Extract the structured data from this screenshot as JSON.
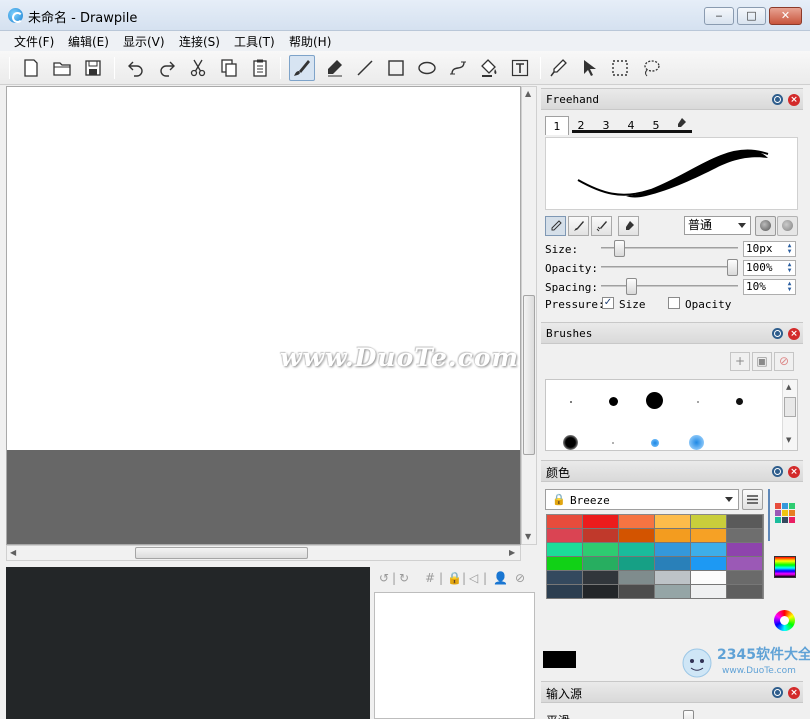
{
  "window": {
    "title": "未命名 - Drawpile",
    "min": "‒",
    "max": "□",
    "close": "✕"
  },
  "menu": [
    "文件(F)",
    "编辑(E)",
    "显示(V)",
    "连接(S)",
    "工具(T)",
    "帮助(H)"
  ],
  "toolbar_icons": [
    "new-file-icon",
    "open-folder-icon",
    "save-icon",
    "undo-icon",
    "redo-icon",
    "cut-icon",
    "copy-icon",
    "paste-icon",
    "freehand-brush-icon",
    "eraser-marker-icon",
    "line-icon",
    "rectangle-icon",
    "ellipse-icon",
    "bezier-icon",
    "fill-bucket-icon",
    "text-tool-icon",
    "color-picker-icon",
    "laser-pointer-icon",
    "rectangle-select-icon",
    "lasso-select-icon"
  ],
  "watermark": "www.DuoTe.com",
  "freehand": {
    "title": "Freehand",
    "tabs": [
      "1",
      "2",
      "3",
      "4",
      "5"
    ],
    "blend_mode": "普通",
    "size_label": "Size:",
    "size_value": "10px",
    "size_level": 0.1,
    "opacity_label": "Opacity:",
    "opacity_value": "100%",
    "opacity_level": 1.0,
    "spacing_label": "Spacing:",
    "spacing_value": "10%",
    "spacing_level": 0.2,
    "pressure_label": "Pressure:",
    "pressure_size": "Size",
    "pressure_size_checked": true,
    "pressure_opacity": "Opacity",
    "pressure_opacity_checked": false
  },
  "brushes": {
    "title": "Brushes"
  },
  "color": {
    "title": "颜色",
    "palette_name": "Breeze",
    "swatches": [
      [
        "#e74c3c",
        "#ec1c1c",
        "#f67442",
        "#fdbc4b",
        "#c9ce3b",
        "#5a5a5a"
      ],
      [
        "#da4453",
        "#c0392b",
        "#d35400",
        "#f39c1f",
        "#f6a125",
        "#6e6e6e"
      ],
      [
        "#1cdc9a",
        "#2ecc71",
        "#1abc9c",
        "#3498db",
        "#3daee9",
        "#8e44ad"
      ],
      [
        "#11d116",
        "#27ae60",
        "#16a085",
        "#2980b9",
        "#1d99f3",
        "#9b59b6"
      ],
      [
        "#34495e",
        "#31363b",
        "#7f8c8d",
        "#bdc3c7",
        "#fcfcfc",
        "#6a6a6a"
      ],
      [
        "#2c3e50",
        "#232629",
        "#4d4d4d",
        "#95a5a6",
        "#eff0f1",
        "#5f5f5f"
      ]
    ]
  },
  "input_dock": {
    "title": "输入源",
    "row_label": "平滑"
  },
  "layer_toolbar": [
    "↺",
    "|",
    "↻",
    "#",
    "|",
    "🔒",
    "|",
    "◁",
    "|",
    "👤",
    "⊘"
  ]
}
